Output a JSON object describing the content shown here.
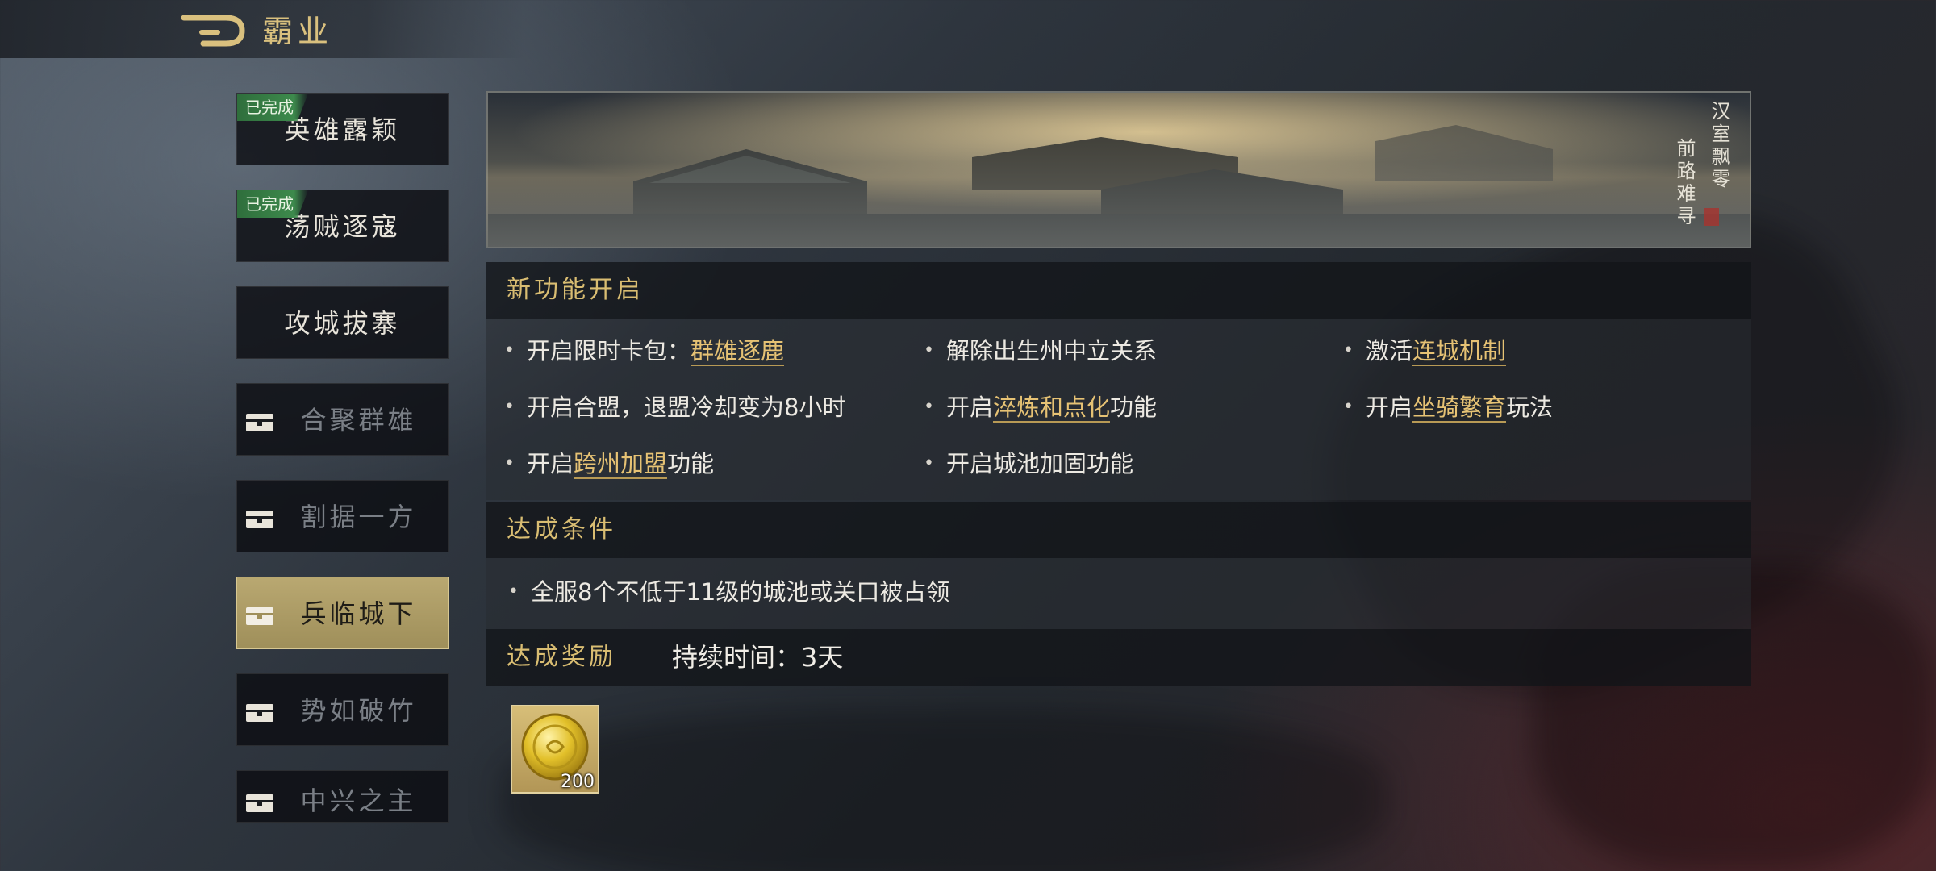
{
  "header": {
    "title": "霸业"
  },
  "sidebar": {
    "done_badge": "已完成",
    "items": [
      {
        "label": "英雄露颖",
        "state": "completed"
      },
      {
        "label": "荡贼逐寇",
        "state": "completed"
      },
      {
        "label": "攻城拔寨",
        "state": "available"
      },
      {
        "label": "合聚群雄",
        "state": "locked"
      },
      {
        "label": "割据一方",
        "state": "locked"
      },
      {
        "label": "兵临城下",
        "state": "selected"
      },
      {
        "label": "势如破竹",
        "state": "locked"
      },
      {
        "label": "中兴之主",
        "state": "locked"
      }
    ]
  },
  "banner": {
    "poem_col1": "汉室飘零",
    "poem_col2": "前路难寻"
  },
  "features": {
    "title": "新功能开启",
    "items": [
      {
        "pre": "开启限时卡包：",
        "hl": "群雄逐鹿",
        "post": ""
      },
      {
        "pre": "解除出生州中立关系",
        "hl": "",
        "post": ""
      },
      {
        "pre": "激活",
        "hl": "连城机制",
        "post": ""
      },
      {
        "pre": "开启合盟，退盟冷却变为8小时",
        "hl": "",
        "post": ""
      },
      {
        "pre": "开启",
        "hl": "淬炼和点化",
        "post": "功能"
      },
      {
        "pre": "开启",
        "hl": "坐骑繁育",
        "post": "玩法"
      },
      {
        "pre": "开启",
        "hl": "跨州加盟",
        "post": "功能"
      },
      {
        "pre": "开启城池加固功能",
        "hl": "",
        "post": ""
      }
    ]
  },
  "conditions": {
    "title": "达成条件",
    "items": [
      "全服8个不低于11级的城池或关口被占领"
    ]
  },
  "rewards": {
    "title": "达成奖励",
    "duration": "持续时间：3天",
    "items": [
      {
        "icon": "gold-coin-icon",
        "count": "200"
      }
    ]
  },
  "colors": {
    "gold_text": "#d9bd72",
    "highlight": "#e6c274",
    "done_green": "#3d8a4c",
    "selected_tab": "#b9a871"
  }
}
